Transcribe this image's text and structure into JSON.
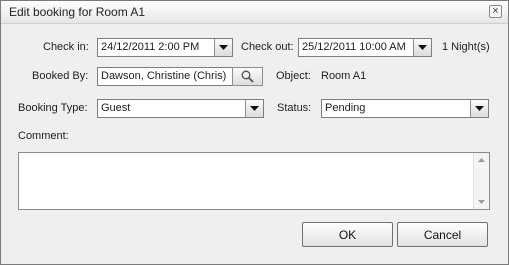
{
  "dialog": {
    "title": "Edit booking for Room A1",
    "close_glyph": "×"
  },
  "form": {
    "check_in": {
      "label": "Check in:",
      "value": "24/12/2011 2:00 PM"
    },
    "check_out": {
      "label": "Check out:",
      "value": "25/12/2011 10:00 AM"
    },
    "nights": "1 Night(s)",
    "booked_by": {
      "label": "Booked By:",
      "value": "Dawson, Christine (Chris)"
    },
    "object": {
      "label": "Object:",
      "value": "Room A1"
    },
    "booking_type": {
      "label": "Booking Type:",
      "value": "Guest"
    },
    "status": {
      "label": "Status:",
      "value": "Pending"
    },
    "comment": {
      "label": "Comment:",
      "value": ""
    }
  },
  "buttons": {
    "ok": "OK",
    "cancel": "Cancel"
  },
  "icons": {
    "dropdown": "chevron-down-icon",
    "search": "magnifier-icon",
    "close": "close-icon"
  },
  "colors": {
    "dialog_bg": "#efefef",
    "field_border": "#7e7e7e",
    "titlebar_top": "#ffffff",
    "titlebar_bottom": "#e6e6e6"
  }
}
